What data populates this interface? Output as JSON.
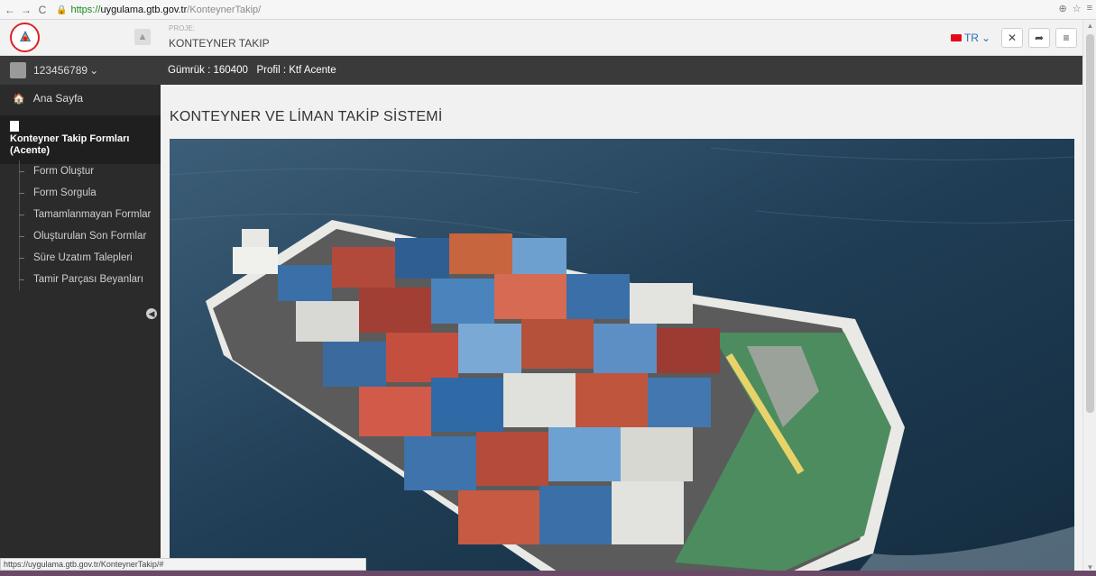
{
  "browser": {
    "url_scheme": "https://",
    "url_host": "uygulama.gtb.gov.tr",
    "url_path": "/KonteynerTakip/",
    "status_url": "https://uygulama.gtb.gov.tr/KonteynerTakip/#"
  },
  "header": {
    "project_label": "PROJE:",
    "project_name": "KONTEYNER TAKIP",
    "language": "TR"
  },
  "sidebar": {
    "username": "123456789",
    "home_label": "Ana Sayfa",
    "group_label": "Konteyner Takip Formları (Acente)",
    "items": [
      {
        "label": "Form Oluştur"
      },
      {
        "label": "Form Sorgula"
      },
      {
        "label": "Tamamlanmayan Formlar"
      },
      {
        "label": "Oluşturulan Son Formlar"
      },
      {
        "label": "Süre Uzatım Talepleri"
      },
      {
        "label": "Tamir Parçası Beyanları"
      }
    ]
  },
  "info_bar": {
    "text": "Gümrük : 160400   Profil : Ktf Acente"
  },
  "main": {
    "title": "KONTEYNER VE LİMAN TAKİP SİSTEMİ"
  },
  "colors": {
    "sidebar_bg": "#2b2b2b",
    "info_bar_bg": "#3a3a3a",
    "accent_red": "#e30a17",
    "link_blue": "#2a6fb7"
  }
}
